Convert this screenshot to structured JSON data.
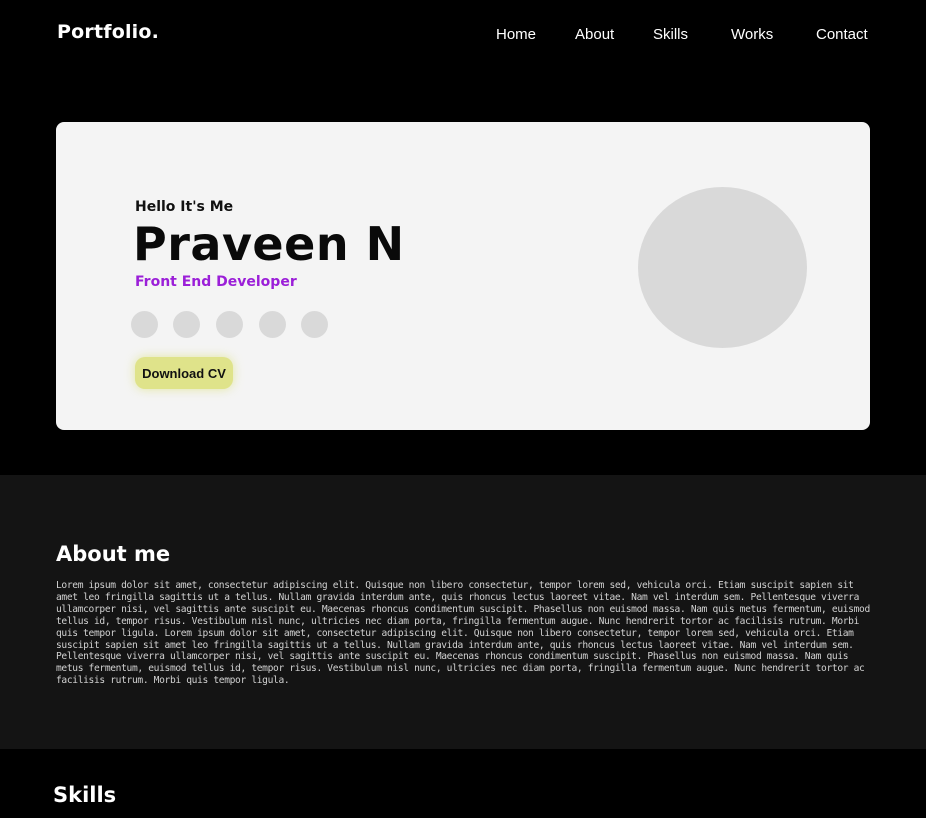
{
  "header": {
    "logo": "Portfolio.",
    "nav": [
      "Home",
      "About",
      "Skills",
      "Works",
      "Contact"
    ]
  },
  "hero": {
    "greeting": "Hello It's Me",
    "name": "Praveen N",
    "role": "Front End Developer",
    "socials": [
      "social-icon-1",
      "social-icon-2",
      "social-icon-3",
      "social-icon-4",
      "social-icon-5"
    ],
    "cv_button": "Download CV"
  },
  "about": {
    "title": "About me",
    "text": "Lorem ipsum dolor sit amet, consectetur adipiscing elit. Quisque non libero consectetur, tempor lorem sed, vehicula orci. Etiam suscipit sapien sit amet leo fringilla sagittis ut a tellus. Nullam gravida interdum ante, quis rhoncus lectus laoreet vitae. Nam vel interdum sem. Pellentesque viverra ullamcorper nisi, vel sagittis ante suscipit eu. Maecenas rhoncus condimentum suscipit. Phasellus non euismod massa. Nam quis metus fermentum, euismod tellus id, tempor risus. Vestibulum nisl nunc, ultricies nec diam porta, fringilla fermentum augue. Nunc hendrerit tortor ac facilisis rutrum. Morbi quis tempor ligula. Lorem ipsum dolor sit amet, consectetur adipiscing elit. Quisque non libero consectetur, tempor lorem sed, vehicula orci. Etiam suscipit sapien sit amet leo fringilla sagittis ut a tellus. Nullam gravida interdum ante, quis rhoncus lectus laoreet vitae. Nam vel interdum sem. Pellentesque viverra ullamcorper nisi, vel sagittis ante suscipit eu. Maecenas rhoncus condimentum suscipit. Phasellus non euismod massa. Nam quis metus fermentum, euismod tellus id, tempor risus. Vestibulum nisl nunc, ultricies nec diam porta, fringilla fermentum augue. Nunc hendrerit tortor ac facilisis rutrum. Morbi quis tempor ligula."
  },
  "skills": {
    "title": "Skills"
  },
  "colors": {
    "background": "#000000",
    "hero_card": "#f4f4f4",
    "accent_role": "#9b1fd8",
    "cv_button": "#dfe38a",
    "about_bg": "#141414"
  }
}
